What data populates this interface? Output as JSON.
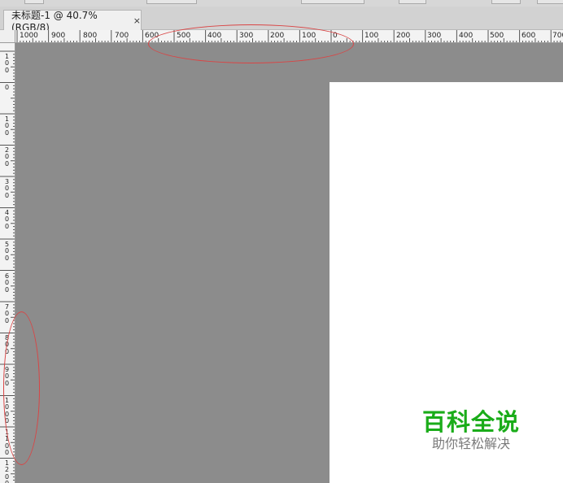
{
  "document_tab": {
    "title": "未标题-1 @ 40.7%(RGB/8)",
    "close_label": "×"
  },
  "rulers": {
    "horizontal_labels": [
      "1000",
      "900",
      "800",
      "700",
      "600",
      "500",
      "400",
      "300",
      "200",
      "100",
      "0",
      "100",
      "200",
      "300",
      "400",
      "500",
      "600",
      "700"
    ],
    "vertical_labels": [
      "100",
      "0",
      "100",
      "200",
      "300",
      "400",
      "500",
      "600",
      "700",
      "800",
      "900",
      "1000",
      "1100",
      "1200"
    ]
  },
  "watermark": {
    "title": "百科全说",
    "subtitle": "助你轻松解决"
  },
  "colors": {
    "pasteboard": "#8c8c8c",
    "canvas": "#ffffff",
    "annotation": "#d94545",
    "watermark_title": "#1aac19"
  }
}
